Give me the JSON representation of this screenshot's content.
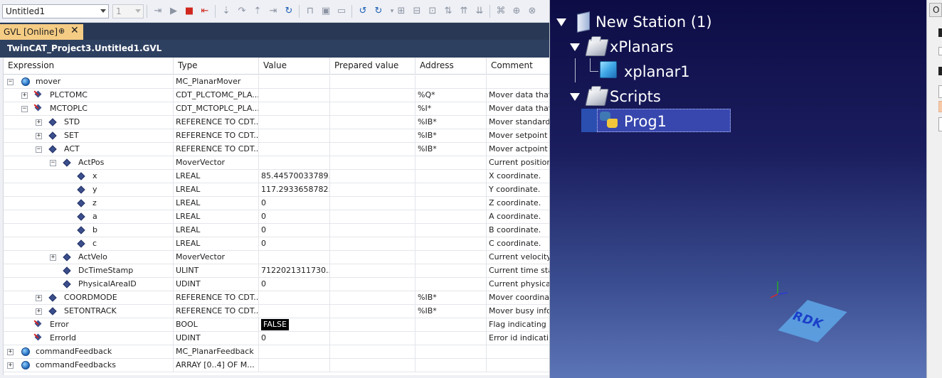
{
  "toolbar": {
    "project_combo": "Untitled1",
    "instance_combo": "1"
  },
  "tab": {
    "label": "GVL [Online]",
    "pin": "⊕",
    "close": "✕"
  },
  "path": "TwinCAT_Project3.Untitled1.GVL",
  "columns": [
    "Expression",
    "Type",
    "Value",
    "Prepared value",
    "Address",
    "Comment"
  ],
  "rows": [
    {
      "expr": "mover",
      "type": "MC_PlanarMover",
      "value": "",
      "prepared": "",
      "address": "",
      "comment": ""
    },
    {
      "expr": "PLCTOMC",
      "type": "CDT_PLCTOMC_PLA...",
      "value": "",
      "prepared": "",
      "address": "%Q*",
      "comment": "Mover data that i"
    },
    {
      "expr": "MCTOPLC",
      "type": "CDT_MCTOPLC_PLA...",
      "value": "",
      "prepared": "",
      "address": "%I*",
      "comment": "Mover data that i"
    },
    {
      "expr": "STD",
      "type": "REFERENCE TO CDT...",
      "value": "",
      "prepared": "",
      "address": "%IB*",
      "comment": "Mover standard c"
    },
    {
      "expr": "SET",
      "type": "REFERENCE TO CDT...",
      "value": "",
      "prepared": "",
      "address": "%IB*",
      "comment": "Mover setpoint d"
    },
    {
      "expr": "ACT",
      "type": "REFERENCE TO CDT...",
      "value": "",
      "prepared": "",
      "address": "%IB*",
      "comment": "Mover actpoint d"
    },
    {
      "expr": "ActPos",
      "type": "MoverVector",
      "value": "",
      "prepared": "",
      "address": "",
      "comment": "Current position."
    },
    {
      "expr": "x",
      "type": "LREAL",
      "value": "85.44570033789...",
      "prepared": "",
      "address": "",
      "comment": "X coordinate."
    },
    {
      "expr": "y",
      "type": "LREAL",
      "value": "117.2933658782...",
      "prepared": "",
      "address": "",
      "comment": "Y coordinate."
    },
    {
      "expr": "z",
      "type": "LREAL",
      "value": "0",
      "prepared": "",
      "address": "",
      "comment": "Z coordinate."
    },
    {
      "expr": "a",
      "type": "LREAL",
      "value": "0",
      "prepared": "",
      "address": "",
      "comment": "A coordinate."
    },
    {
      "expr": "b",
      "type": "LREAL",
      "value": "0",
      "prepared": "",
      "address": "",
      "comment": "B coordinate."
    },
    {
      "expr": "c",
      "type": "LREAL",
      "value": "0",
      "prepared": "",
      "address": "",
      "comment": "C coordinate."
    },
    {
      "expr": "ActVelo",
      "type": "MoverVector",
      "value": "",
      "prepared": "",
      "address": "",
      "comment": "Current velocity."
    },
    {
      "expr": "DcTimeStamp",
      "type": "ULINT",
      "value": "7122021311730...",
      "prepared": "",
      "address": "",
      "comment": "Current time stan"
    },
    {
      "expr": "PhysicalAreaID",
      "type": "UDINT",
      "value": "0",
      "prepared": "",
      "address": "",
      "comment": "Current physical"
    },
    {
      "expr": "COORDMODE",
      "type": "REFERENCE TO CDT...",
      "value": "",
      "prepared": "",
      "address": "%IB*",
      "comment": "Mover coordinate"
    },
    {
      "expr": "SETONTRACK",
      "type": "REFERENCE TO CDT...",
      "value": "",
      "prepared": "",
      "address": "%IB*",
      "comment": "Mover busy infor"
    },
    {
      "expr": "Error",
      "type": "BOOL",
      "value": "FALSE",
      "prepared": "",
      "address": "",
      "comment": "Flag indicating a"
    },
    {
      "expr": "ErrorId",
      "type": "UDINT",
      "value": "0",
      "prepared": "",
      "address": "",
      "comment": "Error id indicatin"
    },
    {
      "expr": "commandFeedback",
      "type": "MC_PlanarFeedback",
      "value": "",
      "prepared": "",
      "address": "",
      "comment": ""
    },
    {
      "expr": "commandFeedbacks",
      "type": "ARRAY [0..4] OF M...",
      "value": "",
      "prepared": "",
      "address": "",
      "comment": ""
    }
  ],
  "robodk": {
    "station": "New Station (1)",
    "xplanars": "xPlanars",
    "xplanar1": "xplanar1",
    "scripts": "Scripts",
    "prog1": "Prog1",
    "plate_label": "RDK"
  },
  "strip": {
    "top_label": "O"
  }
}
